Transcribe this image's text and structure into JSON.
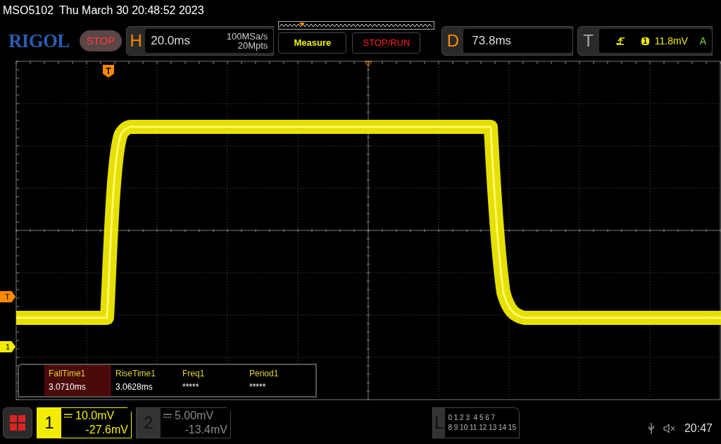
{
  "header": {
    "model": "MSO5102",
    "datetime": "Thu March 30 20:48:52 2023"
  },
  "toolbar": {
    "logo": "RIGOL",
    "run_state": "STOP",
    "horizontal": {
      "label": "H",
      "timebase": "20.0ms",
      "sample_rate": "100MSa/s",
      "memory_depth": "20Mpts"
    },
    "measure_button": "Measure",
    "stop_run_button": "STOP/RUN",
    "delay": {
      "label": "D",
      "value": "73.8ms"
    },
    "trigger": {
      "label": "T",
      "source": "1",
      "level": "11.8mV",
      "mode": "A"
    }
  },
  "markers": {
    "trigger_position": "T",
    "trigger_level": "T",
    "channel": "1"
  },
  "measurements": [
    {
      "name": "FallTime1",
      "value": "3.0710ms",
      "selected": true
    },
    {
      "name": "RiseTime1",
      "value": "3.0628ms",
      "selected": false
    },
    {
      "name": "Freq1",
      "value": "*****",
      "selected": false
    },
    {
      "name": "Period1",
      "value": "*****",
      "selected": false
    }
  ],
  "channels": [
    {
      "number": "1",
      "scale": "10.0mV",
      "offset": "-27.6mV",
      "on": true
    },
    {
      "number": "2",
      "scale": "5.00mV",
      "offset": "-13.4mV",
      "on": false
    }
  ],
  "logic": {
    "label": "L",
    "rows": [
      "0 1 2 3  4 5 6 7",
      "8 9 10 11 12 13 14 15"
    ]
  },
  "status": {
    "time": "20:47"
  }
}
